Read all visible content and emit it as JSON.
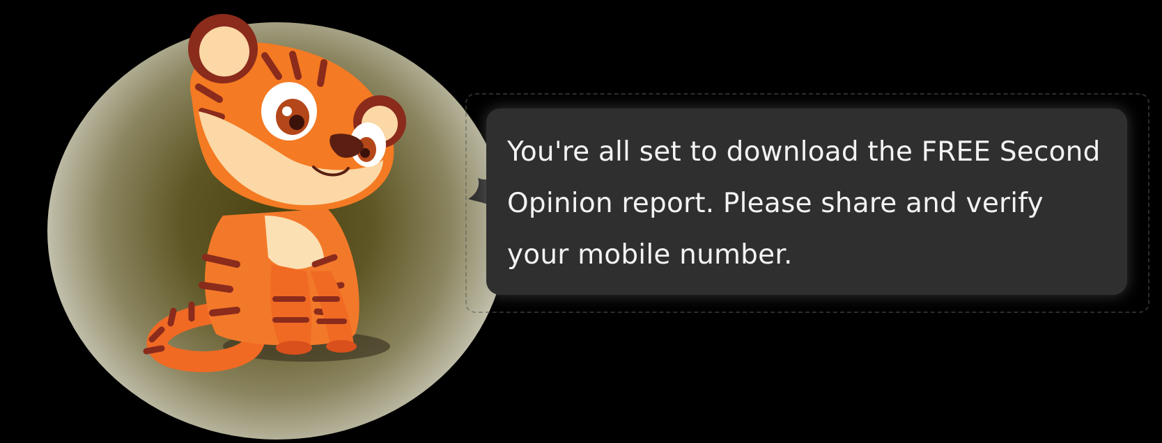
{
  "message": {
    "text": "You're all set to download the FREE Second Opinion report. Please share and verify your mobile number."
  },
  "mascot": {
    "icon": "tiger-cub-mascot-icon"
  },
  "colors": {
    "background": "#000000",
    "bubble": "#2f2f2f",
    "bubble_text": "#f3f3f3",
    "tiger_orange": "#f36d22",
    "tiger_stripe": "#8a2b1c",
    "tiger_cream": "#fbd8a6"
  }
}
